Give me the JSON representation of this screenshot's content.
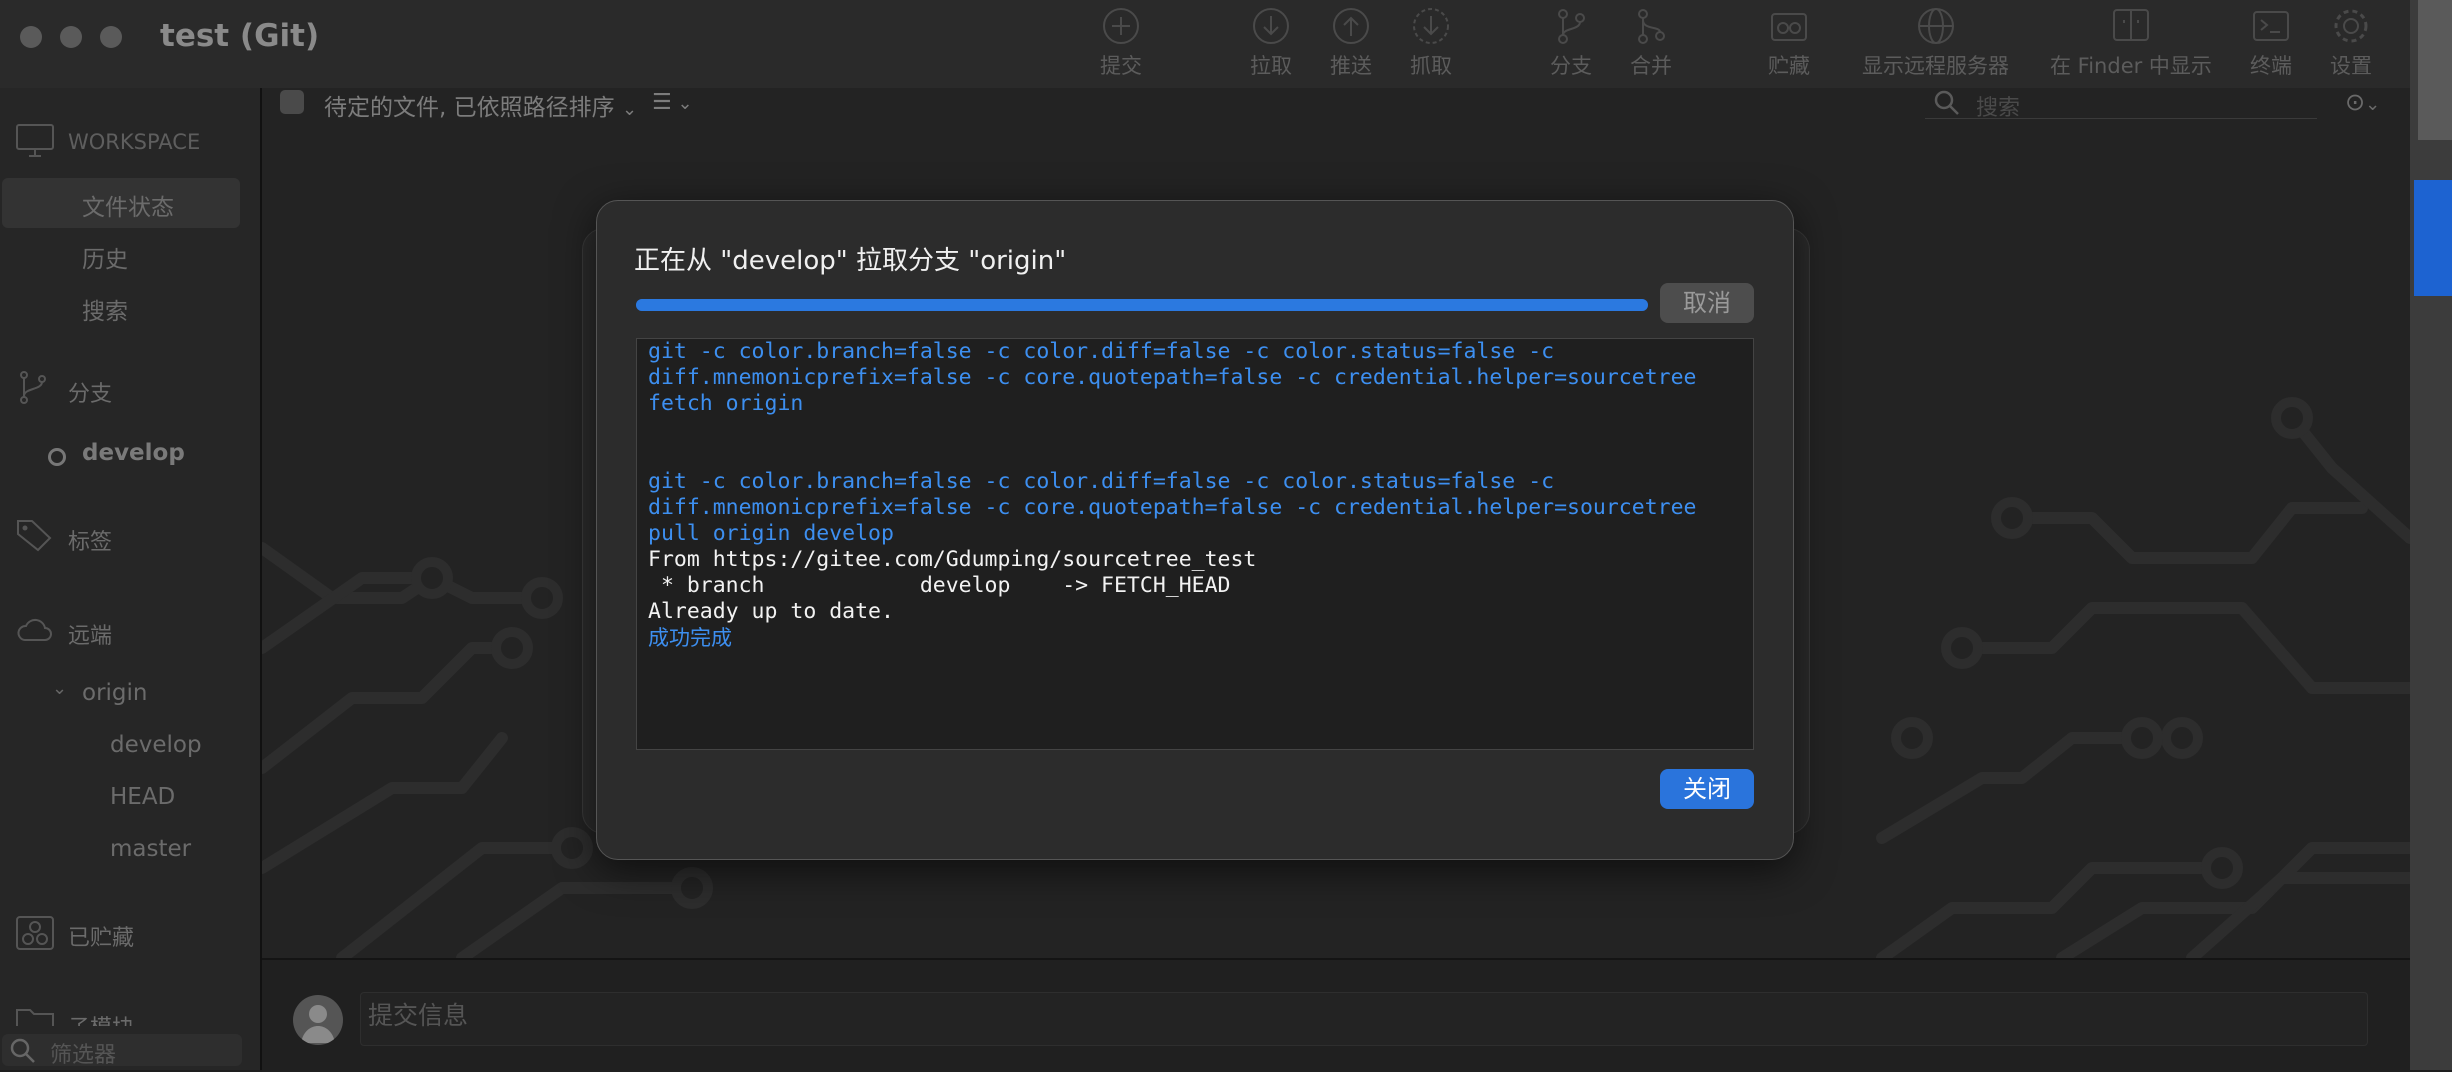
{
  "window": {
    "title": "test (Git)"
  },
  "toolbar": {
    "buttons": [
      {
        "label": "提交",
        "icon": "plus-circle-icon"
      },
      {
        "label": "拉取",
        "icon": "arrow-down-circle-icon"
      },
      {
        "label": "推送",
        "icon": "arrow-up-circle-icon"
      },
      {
        "label": "抓取",
        "icon": "fetch-icon"
      },
      {
        "label": "分支",
        "icon": "branch-icon"
      },
      {
        "label": "合并",
        "icon": "merge-icon"
      },
      {
        "label": "贮藏",
        "icon": "stash-icon"
      },
      {
        "label": "显示远程服务器",
        "icon": "globe-icon"
      },
      {
        "label": "在 Finder 中显示",
        "icon": "finder-icon"
      },
      {
        "label": "终端",
        "icon": "terminal-icon"
      },
      {
        "label": "设置",
        "icon": "gear-icon"
      }
    ]
  },
  "sidebar": {
    "workspace_header": "WORKSPACE",
    "workspace_items": [
      "文件状态",
      "历史",
      "搜索"
    ],
    "branches_header": "分支",
    "branches": [
      "develop"
    ],
    "tags_header": "标签",
    "remotes_header": "远端",
    "remote_name": "origin",
    "remote_branches": [
      "develop",
      "HEAD",
      "master"
    ],
    "stashes_header": "已贮藏",
    "submodules_header": "子模块",
    "filter_placeholder": "筛选器"
  },
  "main": {
    "pending_label": "待定的文件, 已依照路径排序",
    "search_placeholder": "搜索",
    "commit_placeholder": "提交信息"
  },
  "dialog": {
    "title": "正在从 \"develop\" 拉取分支 \"origin\"",
    "progress": 1.0,
    "cancel_label": "取消",
    "close_label": "关闭",
    "log": [
      {
        "text": "git -c color.branch=false -c color.diff=false -c color.status=false -c",
        "kind": "cmd"
      },
      {
        "text": "diff.mnemonicprefix=false -c core.quotepath=false -c credential.helper=sourcetree",
        "kind": "cmd"
      },
      {
        "text": "fetch origin",
        "kind": "cmd"
      },
      {
        "text": "",
        "kind": "blank"
      },
      {
        "text": "",
        "kind": "blank"
      },
      {
        "text": "git -c color.branch=false -c color.diff=false -c color.status=false -c",
        "kind": "cmd"
      },
      {
        "text": "diff.mnemonicprefix=false -c core.quotepath=false -c credential.helper=sourcetree",
        "kind": "cmd"
      },
      {
        "text": "pull origin develop",
        "kind": "cmd"
      },
      {
        "text": "From https://gitee.com/Gdumping/sourcetree_test",
        "kind": "out"
      },
      {
        "text": " * branch            develop    -> FETCH_HEAD",
        "kind": "out"
      },
      {
        "text": "Already up to date.",
        "kind": "out"
      },
      {
        "text": "成功完成",
        "kind": "status"
      }
    ]
  },
  "colors": {
    "accent": "#2a74dc",
    "log_command": "#3d8ff0",
    "log_output": "#f2f2f2",
    "background": "#1e1e1e"
  }
}
